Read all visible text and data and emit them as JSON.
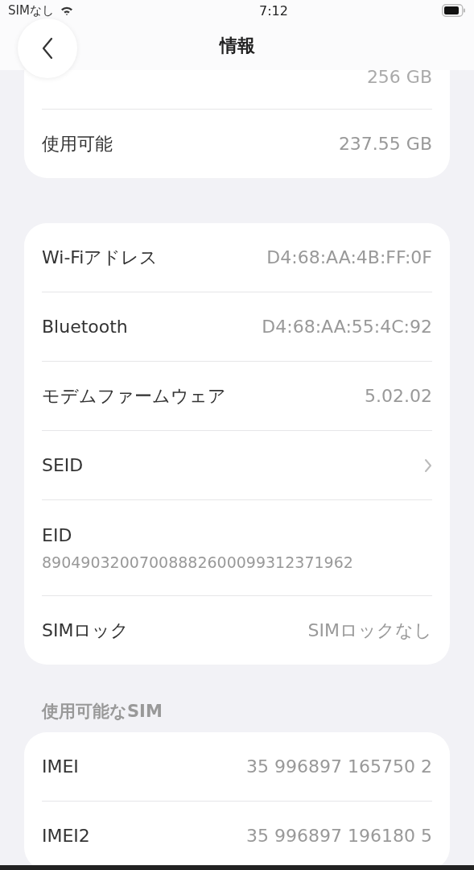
{
  "status_bar": {
    "carrier": "SIMなし",
    "time": "7:12"
  },
  "nav": {
    "title": "情報"
  },
  "groups": [
    {
      "rows": [
        {
          "kind": "value",
          "value": "256 GB"
        },
        {
          "kind": "value",
          "label": "使用可能",
          "value": "237.55 GB"
        }
      ]
    },
    {
      "rows": [
        {
          "kind": "value",
          "label": "Wi-Fiアドレス",
          "value": "D4:68:AA:4B:FF:0F"
        },
        {
          "kind": "value",
          "label": "Bluetooth",
          "value": "D4:68:AA:55:4C:92"
        },
        {
          "kind": "value",
          "label": "モデムファームウェア",
          "value": "5.02.02"
        },
        {
          "kind": "chevron",
          "label": "SEID"
        },
        {
          "kind": "stacked",
          "label": "EID",
          "value": "89049032007008882600099312371962"
        },
        {
          "kind": "value",
          "label": "SIMロック",
          "value": "SIMロックなし"
        }
      ]
    },
    {
      "header": "使用可能なSIM",
      "rows": [
        {
          "kind": "value",
          "label": "IMEI",
          "value": "35 996897 165750 2"
        },
        {
          "kind": "value",
          "label": "IMEI2",
          "value": "35 996897 196180 5"
        }
      ]
    }
  ]
}
